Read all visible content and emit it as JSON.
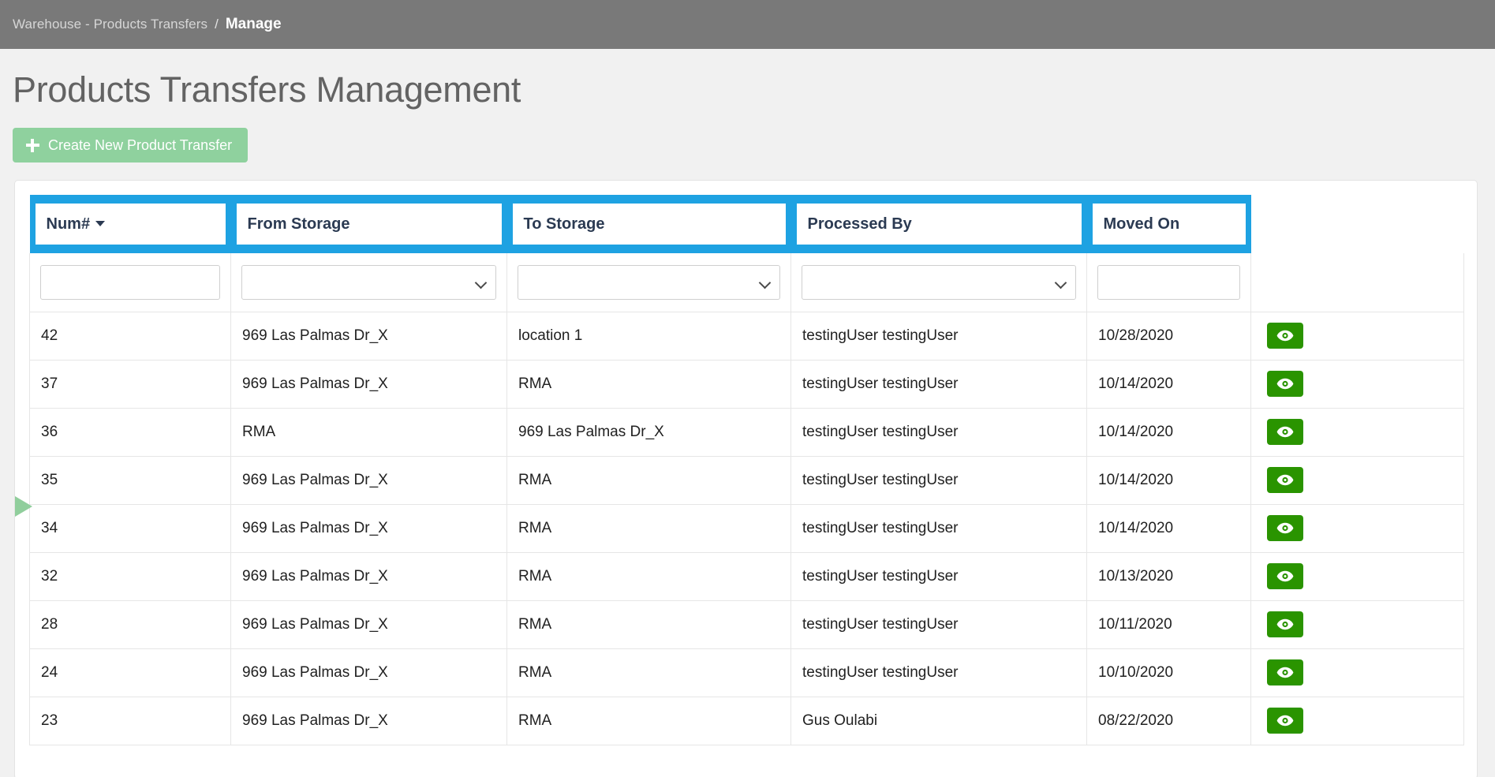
{
  "breadcrumb": {
    "parent": "Warehouse - Products Transfers",
    "separator": "/",
    "current": "Manage"
  },
  "page": {
    "title": "Products Transfers Management",
    "create_button": "Create New Product Transfer",
    "plus_icon": "plus-icon"
  },
  "colors": {
    "header_blue": "#1ea2e2",
    "breadcrumb_gray": "#797979",
    "create_green": "#8fd19e",
    "view_green": "#2a9400",
    "marker_green": "#90ce9c"
  },
  "table": {
    "columns": [
      {
        "label": "Num#",
        "sortable": true,
        "sort_caret": "caret-down-icon"
      },
      {
        "label": "From Storage",
        "sortable": false
      },
      {
        "label": "To Storage",
        "sortable": false
      },
      {
        "label": "Processed By",
        "sortable": false
      },
      {
        "label": "Moved On",
        "sortable": false
      },
      {
        "label": "",
        "sortable": false
      }
    ],
    "filters": {
      "num": {
        "type": "text",
        "value": "",
        "placeholder": ""
      },
      "from_storage": {
        "type": "select",
        "value": "",
        "options": [
          ""
        ]
      },
      "to_storage": {
        "type": "select",
        "value": "",
        "options": [
          ""
        ]
      },
      "processed_by": {
        "type": "select",
        "value": "",
        "options": [
          ""
        ]
      },
      "moved_on": {
        "type": "text",
        "value": "",
        "placeholder": ""
      }
    },
    "rows": [
      {
        "num": "42",
        "from_storage": "969 Las Palmas Dr_X",
        "to_storage": "location 1",
        "processed_by": "testingUser testingUser",
        "moved_on": "10/28/2020",
        "action": "view-icon"
      },
      {
        "num": "37",
        "from_storage": "969 Las Palmas Dr_X",
        "to_storage": "RMA",
        "processed_by": "testingUser testingUser",
        "moved_on": "10/14/2020",
        "action": "view-icon"
      },
      {
        "num": "36",
        "from_storage": "RMA",
        "to_storage": "969 Las Palmas Dr_X",
        "processed_by": "testingUser testingUser",
        "moved_on": "10/14/2020",
        "action": "view-icon"
      },
      {
        "num": "35",
        "from_storage": "969 Las Palmas Dr_X",
        "to_storage": "RMA",
        "processed_by": "testingUser testingUser",
        "moved_on": "10/14/2020",
        "action": "view-icon"
      },
      {
        "num": "34",
        "from_storage": "969 Las Palmas Dr_X",
        "to_storage": "RMA",
        "processed_by": "testingUser testingUser",
        "moved_on": "10/14/2020",
        "action": "view-icon"
      },
      {
        "num": "32",
        "from_storage": "969 Las Palmas Dr_X",
        "to_storage": "RMA",
        "processed_by": "testingUser testingUser",
        "moved_on": "10/13/2020",
        "action": "view-icon"
      },
      {
        "num": "28",
        "from_storage": "969 Las Palmas Dr_X",
        "to_storage": "RMA",
        "processed_by": "testingUser testingUser",
        "moved_on": "10/11/2020",
        "action": "view-icon"
      },
      {
        "num": "24",
        "from_storage": "969 Las Palmas Dr_X",
        "to_storage": "RMA",
        "processed_by": "testingUser testingUser",
        "moved_on": "10/10/2020",
        "action": "view-icon"
      },
      {
        "num": "23",
        "from_storage": "969 Las Palmas Dr_X",
        "to_storage": "RMA",
        "processed_by": "Gus Oulabi",
        "moved_on": "08/22/2020",
        "action": "view-icon"
      }
    ]
  }
}
